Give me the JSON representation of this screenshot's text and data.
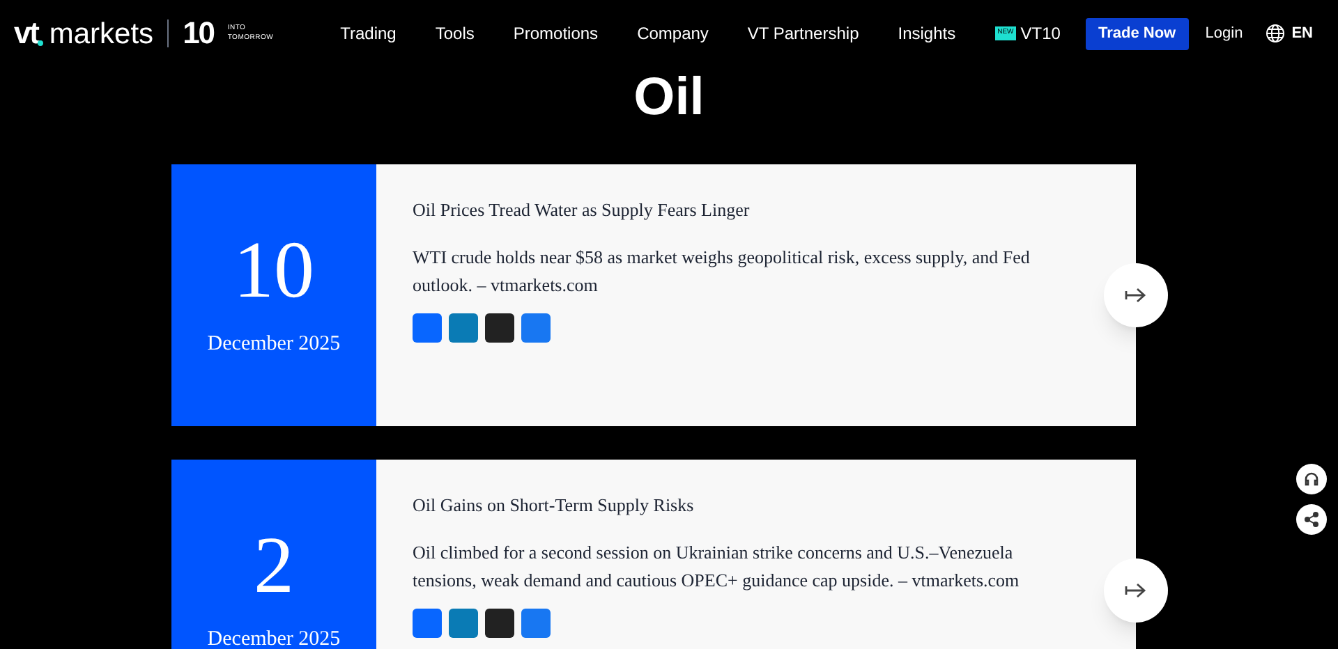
{
  "header": {
    "logo": {
      "brand": "markets",
      "mark": "vt",
      "anniversary": "10",
      "tagline_1": "INTO",
      "tagline_2": "TOMORROW"
    },
    "nav": [
      {
        "label": "Trading"
      },
      {
        "label": "Tools"
      },
      {
        "label": "Promotions"
      },
      {
        "label": "Company"
      },
      {
        "label": "VT Partnership"
      },
      {
        "label": "Insights"
      },
      {
        "label": "VT10",
        "badge": "NEW"
      }
    ],
    "cta": "Trade Now",
    "login": "Login",
    "language": "EN"
  },
  "page_title": "Oil",
  "articles": [
    {
      "day": "10",
      "month": "December 2025",
      "title": "Oil Prices Tread Water as Supply Fears Linger",
      "summary": "WTI crude holds near $58 as market weighs geopolitical risk, excess supply, and Fed outlook. – vtmarkets.com",
      "share": [
        {
          "color": "#0866ff"
        },
        {
          "color": "#0a7bb5"
        },
        {
          "color": "#222222"
        },
        {
          "color": "#1877f2"
        }
      ]
    },
    {
      "day": "2",
      "month": "December 2025",
      "title": "Oil Gains on Short-Term Supply Risks",
      "summary": "Oil climbed for a second session on Ukrainian strike concerns and U.S.–Venezuela tensions, weak demand and cautious OPEC+ guidance cap upside. – vtmarkets.com",
      "share": [
        {
          "color": "#0866ff"
        },
        {
          "color": "#0a7bb5"
        },
        {
          "color": "#222222"
        },
        {
          "color": "#1877f2"
        }
      ]
    }
  ]
}
